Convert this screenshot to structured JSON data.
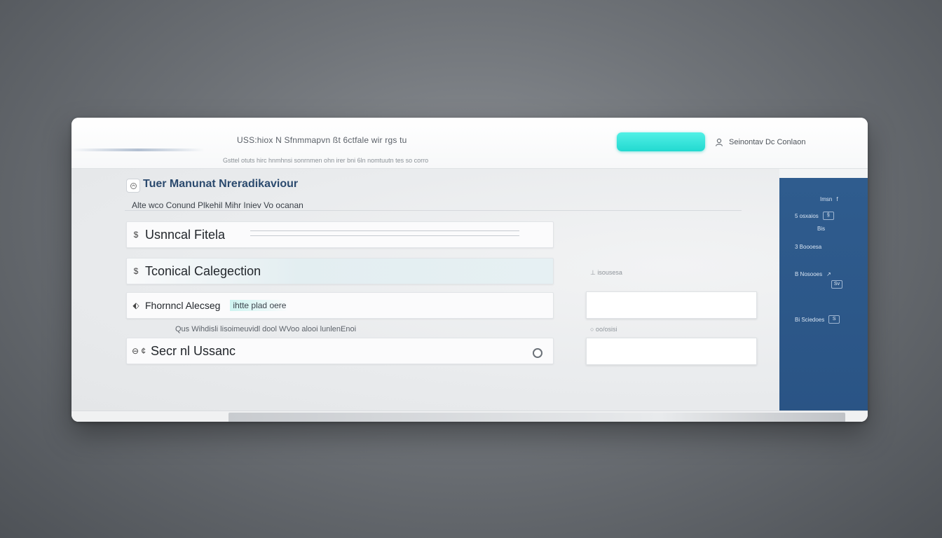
{
  "header": {
    "title": "USS:hiox N Sfnmmapvn ßt 6ctfale wir rgs tu",
    "subtitle": "Gsttel otuts hirc hnmhnsi sonrnmen ohn irer bni 6ln nomtuutn tes so corro",
    "primary_button_label": "",
    "user_label": "Seinontav Dc Conlaon",
    "icon_user": "user-icon"
  },
  "page": {
    "title": "Tuer Manunat Nreradikaviour",
    "subtitle": "Alte wco Conund Plkehil Mihr Iniev Vo ocanan"
  },
  "fields": [
    {
      "icon": "$",
      "label": "Usnncal Fitela"
    },
    {
      "icon": "$",
      "label": "Tconical Calegection"
    },
    {
      "icon": "⬖",
      "label": "Fhornncl Alecseg",
      "hint": "ihtte plad oere"
    },
    {
      "icon": "⊖ ¢",
      "label": "Secr nl Ussanc"
    }
  ],
  "helper_text": "Qus Wihdisli lisoimeuvidl dool WVoo alooi lunlenEnoi",
  "side": {
    "label_1": "⊥ isousesa",
    "label_2": "○ oo/osisi"
  },
  "right_panel": {
    "items": [
      {
        "text": "Imsn",
        "chip": "f"
      },
      {
        "text": "5 osxaios",
        "chip": "§"
      },
      {
        "text": "Bis",
        "chip": ""
      },
      {
        "text": "3 Boooesa",
        "chip": ""
      },
      {
        "text": "B Nosooes",
        "chip": "↗"
      },
      {
        "text": "Sv",
        "chip": ""
      },
      {
        "text": "Bi Sciedoes",
        "chip": "S"
      }
    ]
  },
  "colors": {
    "accent_cyan": "#22d9d0",
    "panel_blue": "#2f5c8e",
    "title_blue": "#2b4a6e"
  }
}
